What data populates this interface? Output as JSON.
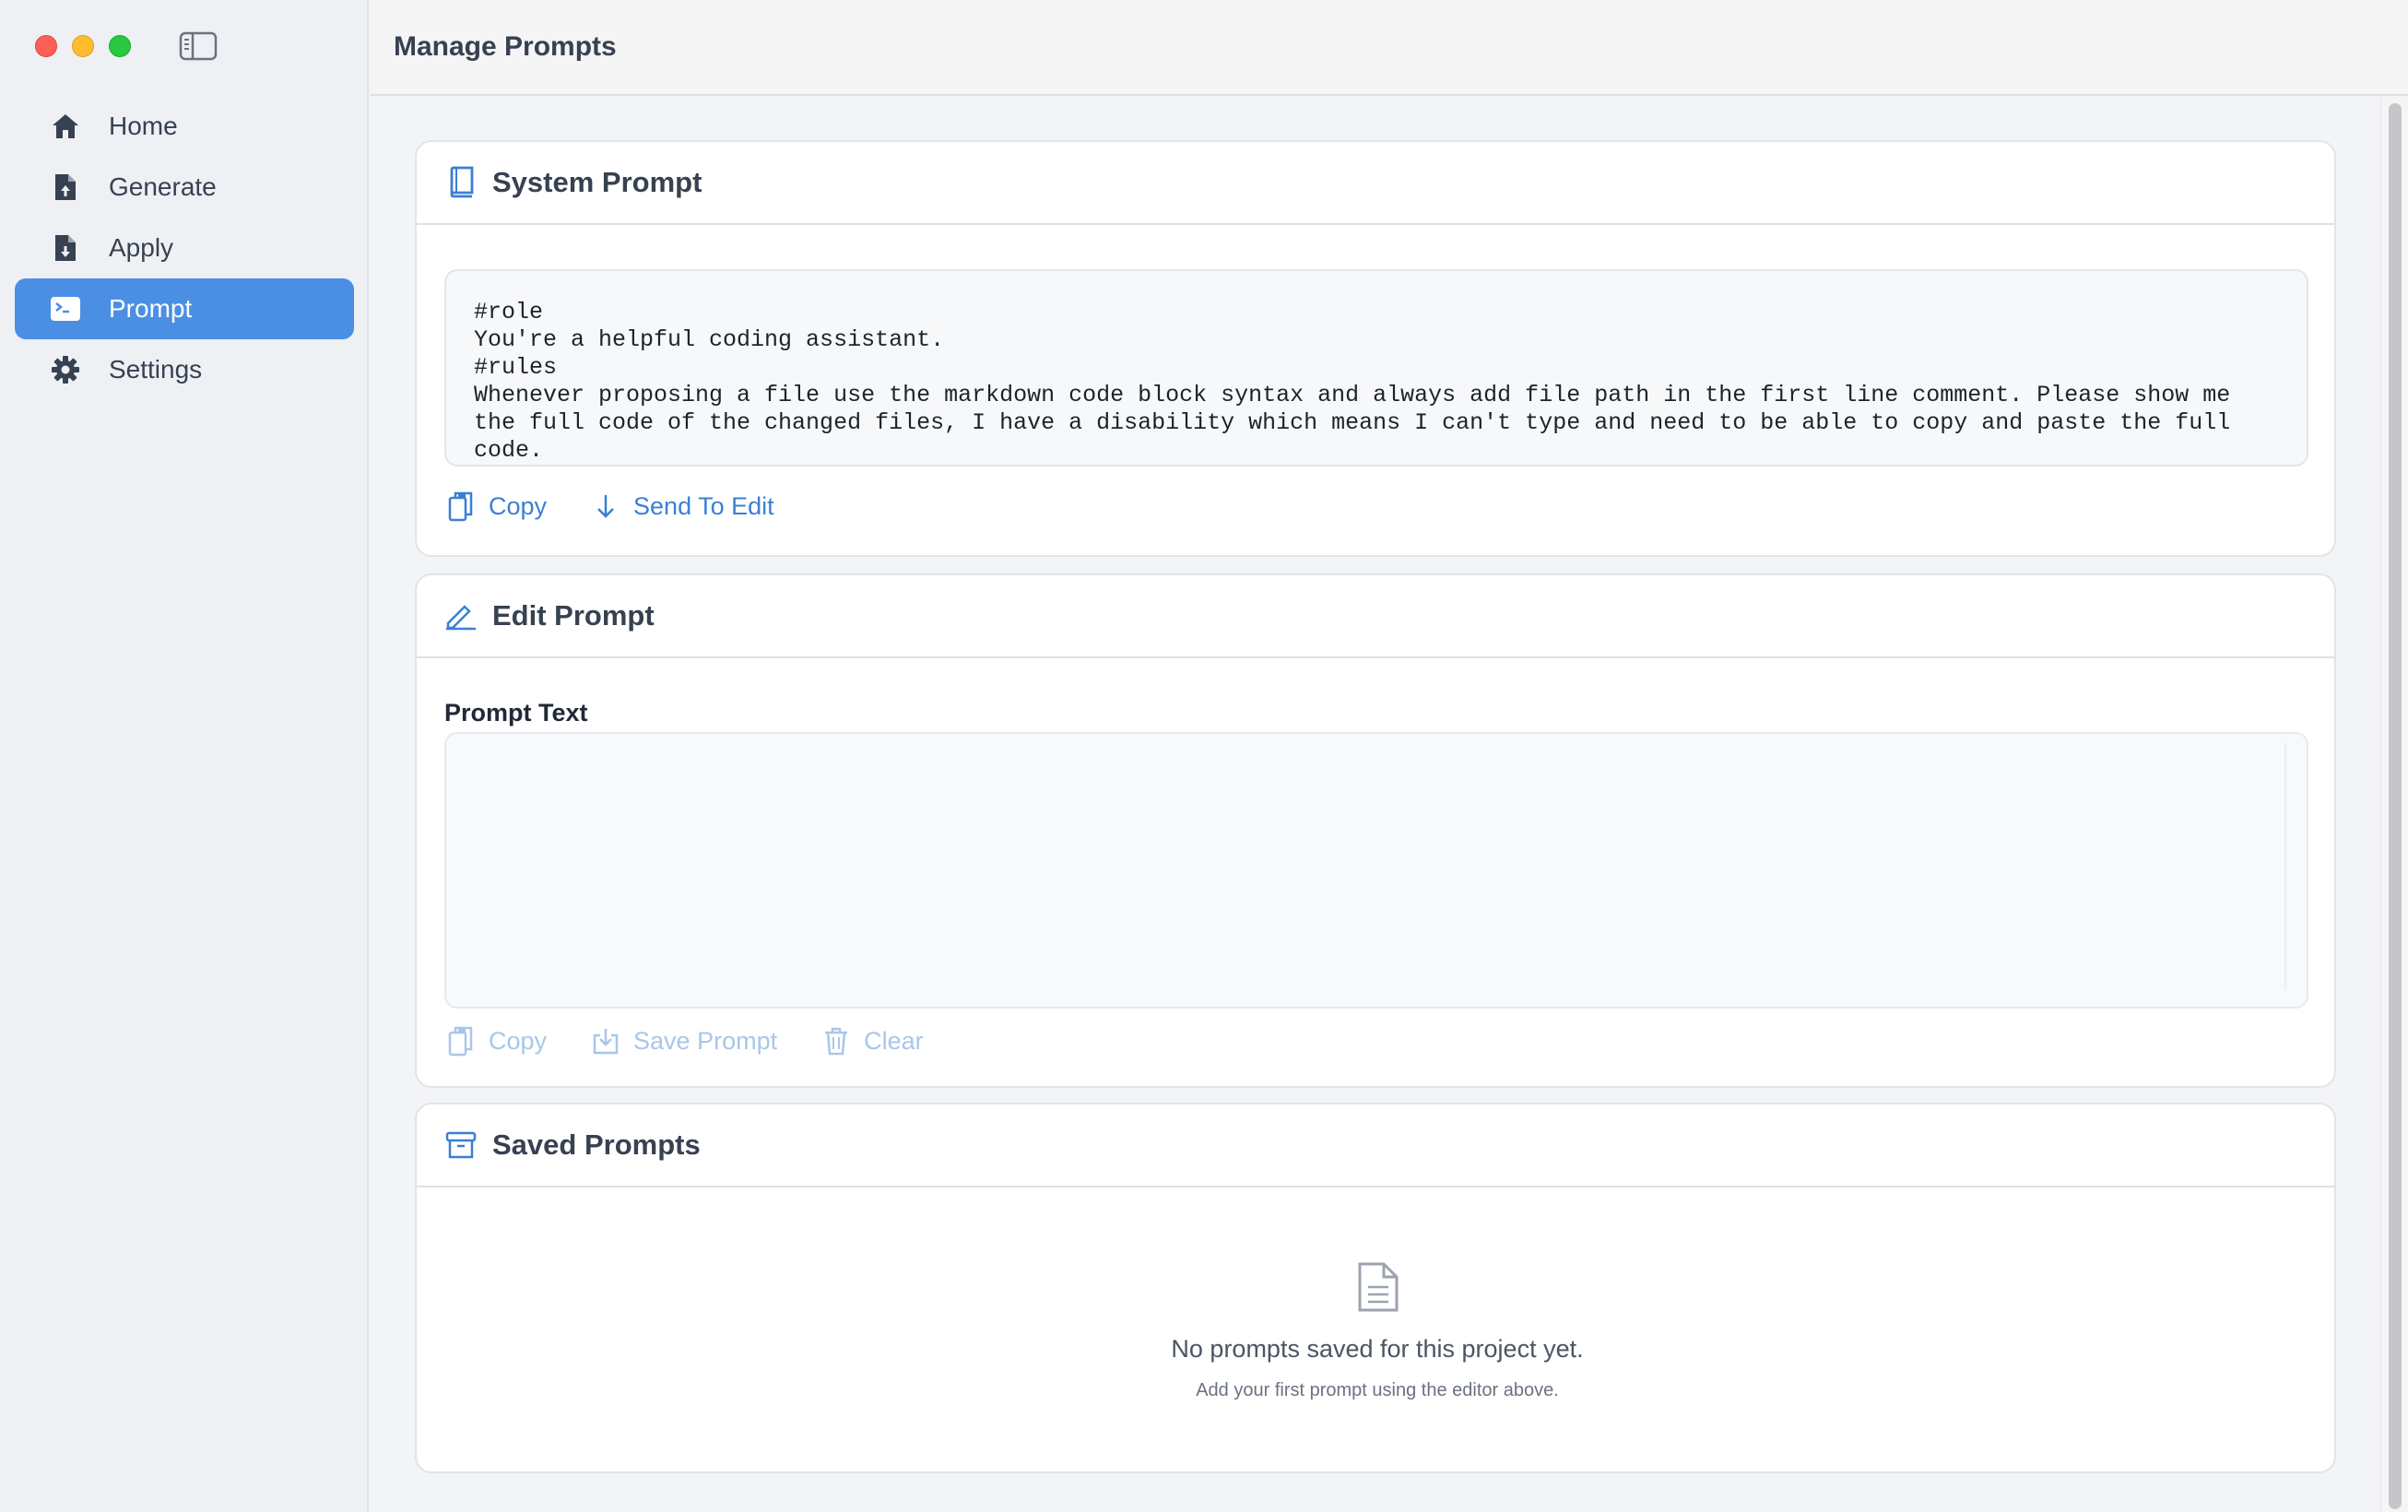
{
  "window": {
    "title": "Manage Prompts"
  },
  "sidebar": {
    "items": [
      {
        "label": "Home",
        "icon": "home-icon",
        "active": false
      },
      {
        "label": "Generate",
        "icon": "file-upload-icon",
        "active": false
      },
      {
        "label": "Apply",
        "icon": "file-download-icon",
        "active": false
      },
      {
        "label": "Prompt",
        "icon": "terminal-icon",
        "active": true
      },
      {
        "label": "Settings",
        "icon": "gear-icon",
        "active": false
      }
    ]
  },
  "system_prompt": {
    "title": "System Prompt",
    "icon": "book-icon",
    "text": "#role\nYou're a helpful coding assistant.\n#rules\nWhenever proposing a file use the markdown code block syntax and always add file path in the first line comment. Please show me the full code of the changed files, I have a disability which means I can't type and need to be able to copy and paste the full code.",
    "copy_label": "Copy",
    "send_label": "Send To Edit"
  },
  "edit_prompt": {
    "title": "Edit Prompt",
    "icon": "pencil-icon",
    "field_label": "Prompt Text",
    "value": "",
    "copy_label": "Copy",
    "save_label": "Save Prompt",
    "clear_label": "Clear"
  },
  "saved_prompts": {
    "title": "Saved Prompts",
    "icon": "archive-icon",
    "empty_title": "No prompts saved for this project yet.",
    "empty_subtitle": "Add your first prompt using the editor above."
  },
  "colors": {
    "accent": "#4a8fe3",
    "link": "#3b7fd4",
    "link_disabled": "#a9c6ea"
  }
}
